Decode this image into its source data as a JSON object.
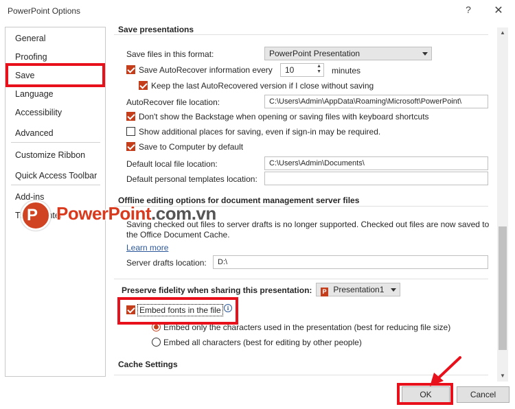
{
  "window": {
    "title": "PowerPoint Options",
    "help": "?",
    "close": "✕"
  },
  "sidebar": {
    "items": [
      {
        "label": "General"
      },
      {
        "label": "Proofing"
      },
      {
        "label": "Save",
        "selected": true
      },
      {
        "label": "Language"
      },
      {
        "label": "Accessibility"
      },
      {
        "label": "Advanced"
      },
      {
        "label": "Customize Ribbon"
      },
      {
        "label": "Quick Access Toolbar"
      },
      {
        "label": "Add-ins"
      },
      {
        "label": "Trust Center"
      }
    ]
  },
  "save_presentations": {
    "heading": "Save presentations",
    "format_label": "Save files in this format:",
    "format_value": "PowerPoint Presentation",
    "autorecover_label": "Save AutoRecover information every",
    "autorecover_checked": true,
    "autorecover_minutes": "10",
    "minutes_label": "minutes",
    "keep_last_label": "Keep the last AutoRecovered version if I close without saving",
    "keep_last_checked": true,
    "ar_location_label": "AutoRecover file location:",
    "ar_location_value": "C:\\Users\\Admin\\AppData\\Roaming\\Microsoft\\PowerPoint\\",
    "backstage_label": "Don't show the Backstage when opening or saving files with keyboard shortcuts",
    "backstage_checked": true,
    "additional_places_label": "Show additional places for saving, even if sign-in may be required.",
    "additional_places_checked": false,
    "save_to_computer_label": "Save to Computer by default",
    "save_to_computer_checked": true,
    "default_local_label": "Default local file location:",
    "default_local_value": "C:\\Users\\Admin\\Documents\\",
    "templates_label": "Default personal templates location:",
    "templates_value": ""
  },
  "offline": {
    "heading": "Offline editing options for document management server files",
    "note_line1": "Saving checked out files to server drafts is no longer supported. Checked out files are now saved to",
    "note_line2": "the Office Document Cache.",
    "learn_more": "Learn more",
    "server_drafts_label": "Server drafts location:",
    "server_drafts_value": "D:\\"
  },
  "fidelity": {
    "heading": "Preserve fidelity when sharing this presentation:",
    "presentation": "Presentation1",
    "embed_label": "Embed fonts in the file",
    "embed_checked": true,
    "info": "i",
    "only_used_label": "Embed only the characters used in the presentation (best for reducing file size)",
    "only_used_selected": true,
    "all_chars_label": "Embed all characters (best for editing by other people)",
    "all_chars_selected": false
  },
  "cache": {
    "heading": "Cache Settings"
  },
  "buttons": {
    "ok": "OK",
    "cancel": "Cancel"
  },
  "watermark": {
    "brand": "PowerPoint",
    "suffix": ".com.vn",
    "icon_letter": "P"
  },
  "colors": {
    "highlight": "#e8101a",
    "accent": "#c43e1c",
    "link": "#2b579a"
  }
}
